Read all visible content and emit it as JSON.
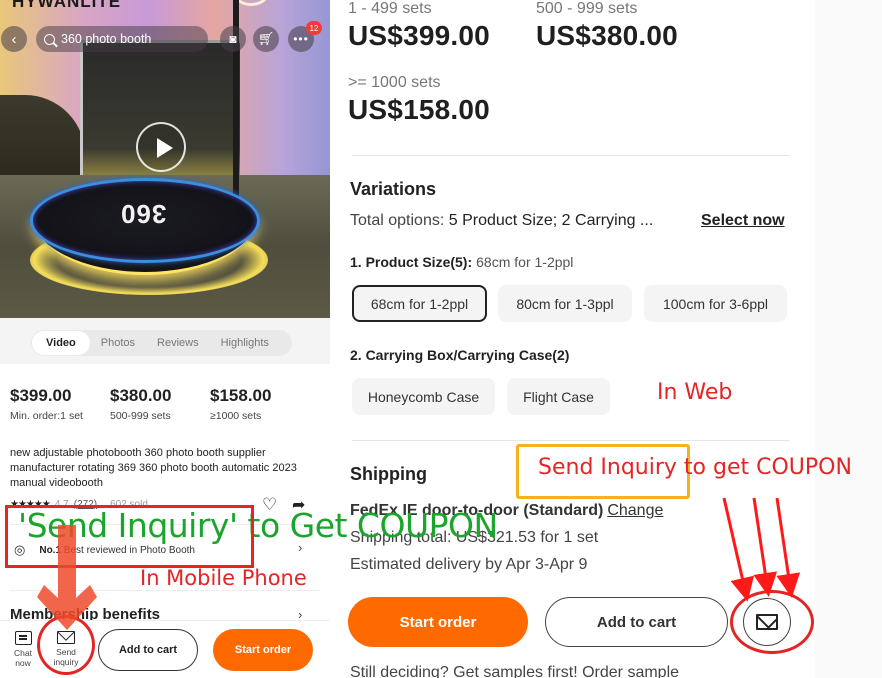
{
  "mobile": {
    "brand_logo_text": "HYWANLITE",
    "search": {
      "value": "360 photo booth"
    },
    "menu_badge_count": "12",
    "hero_brand_text": "360",
    "media_tabs": [
      {
        "label": "Video",
        "active": true
      },
      {
        "label": "Photos",
        "active": false
      },
      {
        "label": "Reviews",
        "active": false
      },
      {
        "label": "Highlights",
        "active": false
      }
    ],
    "prices": [
      {
        "value": "$399.00",
        "sub": "Min. order:1 set"
      },
      {
        "value": "$380.00",
        "sub": "500-999 sets"
      },
      {
        "value": "$158.00",
        "sub": "≥1000 sets"
      }
    ],
    "product_title": "new adjustable photobooth 360 photo booth supplier manufacturer rotating 369 360 photo booth automatic 2023 manual videobooth",
    "rating": {
      "stars": "★★★★★",
      "score": "4.7",
      "count": "(272)",
      "sold": "602 sold"
    },
    "best": {
      "rank": "No.1",
      "text": "Best reviewed in Photo Booth"
    },
    "membership": "Membership benefits",
    "bottom_bar": {
      "chat_label": "Chat now",
      "inquiry_label": "Send inquiry",
      "add_to_cart": "Add to cart",
      "start_order": "Start order"
    }
  },
  "web": {
    "tiers": [
      {
        "label": "1 - 499 sets",
        "price": "US$399.00"
      },
      {
        "label": "500 - 999 sets",
        "price": "US$380.00"
      },
      {
        "label": ">= 1000 sets",
        "price": "US$158.00"
      }
    ],
    "variations": {
      "heading": "Variations",
      "total_prefix": "Total options:",
      "total_value": "5 Product Size; 2 Carrying ...",
      "select_now": "Select now",
      "groups": [
        {
          "label": "1. Product Size(5):",
          "selected_value": "68cm for 1-2ppl",
          "options": [
            {
              "label": "68cm for 1-2ppl",
              "selected": true
            },
            {
              "label": "80cm for 1-3ppl",
              "selected": false
            },
            {
              "label": "100cm for 3-6ppl",
              "selected": false
            }
          ]
        },
        {
          "label": "2. Carrying Box/Carrying Case(2)",
          "selected_value": "",
          "options": [
            {
              "label": "Honeycomb Case",
              "selected": false
            },
            {
              "label": "Flight Case",
              "selected": false
            }
          ]
        }
      ]
    },
    "shipping": {
      "heading": "Shipping",
      "method": "FedEx IE door-to-door (Standard)",
      "change_link": "Change",
      "total": "Shipping total: US$321.53 for 1 set",
      "delivery": "Estimated delivery by Apr 3-Apr 9"
    },
    "actions": {
      "start_order": "Start order",
      "add_to_cart": "Add to cart"
    },
    "sample_text": "Still deciding? Get samples first! Order sample"
  },
  "annotations": {
    "mobile_callout": "'Send Inquiry' to Get COUPON",
    "mobile_label": "In Mobile Phone",
    "web_label": "In Web",
    "web_callout": "Send Inquiry to get COUPON",
    "colors": {
      "red": "#e52424",
      "green": "#1aa52c",
      "yellow": "#f5b21c",
      "orange": "#ff6a00"
    }
  }
}
